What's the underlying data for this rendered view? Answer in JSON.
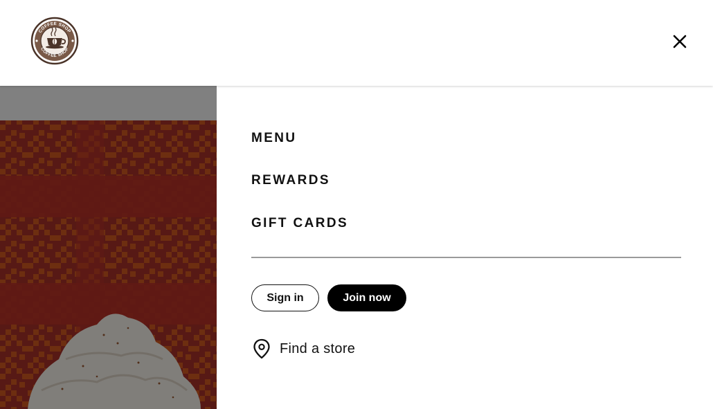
{
  "header": {
    "logo_text_top": "COFFEE SHOP",
    "logo_text_bottom": "COFFEE SHOP",
    "close_icon": "close-icon"
  },
  "nav": {
    "items": [
      {
        "label": "MENU"
      },
      {
        "label": "REWARDS"
      },
      {
        "label": "GIFT CARDS"
      }
    ]
  },
  "auth": {
    "sign_in_label": "Sign in",
    "join_label": "Join now"
  },
  "store": {
    "icon": "location-pin-icon",
    "label": "Find a store"
  },
  "colors": {
    "brand_dark": "#000000",
    "text": "#111111",
    "hero_red": "#a8302a",
    "hero_orange": "#d2581f"
  }
}
